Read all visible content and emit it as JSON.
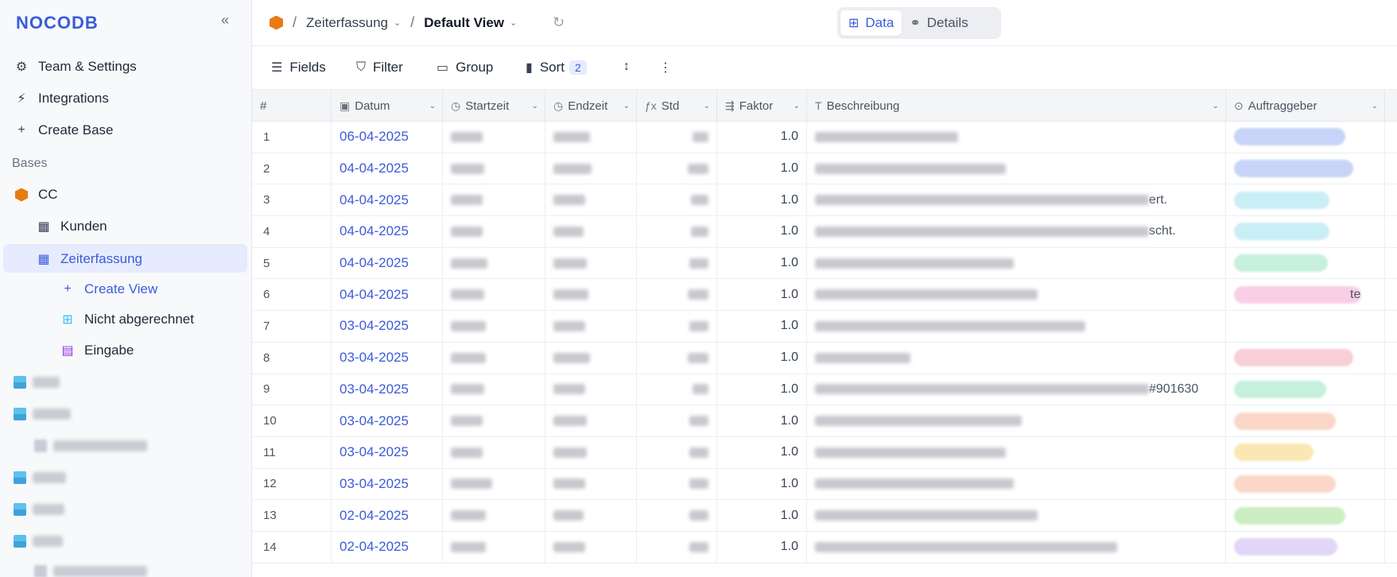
{
  "sidebar": {
    "logo": "NOCODB",
    "collapse": "«",
    "team_settings": "Team & Settings",
    "integrations": "Integrations",
    "create_base": "Create Base",
    "bases_label": "Bases",
    "base_name": "CC",
    "tables": [
      "Kunden",
      "Zeiterfassung"
    ],
    "create_view": "Create View",
    "views": [
      "Nicht abgerechnet",
      "Eingabe"
    ]
  },
  "topbar": {
    "breadcrumb_table": "Zeiterfassung",
    "breadcrumb_view": "Default View",
    "tab_data": "Data",
    "tab_details": "Details"
  },
  "toolbar": {
    "fields": "Fields",
    "filter": "Filter",
    "group": "Group",
    "sort": "Sort",
    "sort_count": "2"
  },
  "grid": {
    "columns": [
      "#",
      "Datum",
      "Startzeit",
      "Endzeit",
      "Std",
      "Faktor",
      "Beschreibung",
      "Auftraggeber"
    ],
    "rows": [
      {
        "n": "1",
        "datum": "06-04-2025",
        "faktor": "1.0",
        "suffix": "",
        "pill": "#c7d4f7"
      },
      {
        "n": "2",
        "datum": "04-04-2025",
        "faktor": "1.0",
        "suffix": "",
        "pill": "#c7d4f7"
      },
      {
        "n": "3",
        "datum": "04-04-2025",
        "faktor": "1.0",
        "suffix": "ert.",
        "pill": "#c9eef6"
      },
      {
        "n": "4",
        "datum": "04-04-2025",
        "faktor": "1.0",
        "suffix": "scht.",
        "pill": "#c9eef6"
      },
      {
        "n": "5",
        "datum": "04-04-2025",
        "faktor": "1.0",
        "suffix": "",
        "pill": "#c6f0dc"
      },
      {
        "n": "6",
        "datum": "04-04-2025",
        "faktor": "1.0",
        "suffix": "",
        "pill": "#f9cfe6",
        "pill_suffix": "te"
      },
      {
        "n": "7",
        "datum": "03-04-2025",
        "faktor": "1.0",
        "suffix": "",
        "pill": ""
      },
      {
        "n": "8",
        "datum": "03-04-2025",
        "faktor": "1.0",
        "suffix": "",
        "pill": "#f8cfd6"
      },
      {
        "n": "9",
        "datum": "03-04-2025",
        "faktor": "1.0",
        "suffix": "#901630",
        "pill": "#c6f0dc"
      },
      {
        "n": "10",
        "datum": "03-04-2025",
        "faktor": "1.0",
        "suffix": "",
        "pill": "#fbd7c9"
      },
      {
        "n": "11",
        "datum": "03-04-2025",
        "faktor": "1.0",
        "suffix": "",
        "pill": "#fbe7b3"
      },
      {
        "n": "12",
        "datum": "03-04-2025",
        "faktor": "1.0",
        "suffix": "",
        "pill": "#fbd7c9"
      },
      {
        "n": "13",
        "datum": "02-04-2025",
        "faktor": "1.0",
        "suffix": "",
        "pill": "#cdeec3"
      },
      {
        "n": "14",
        "datum": "02-04-2025",
        "faktor": "1.0",
        "suffix": "",
        "pill": "#e1d6f7"
      }
    ]
  }
}
